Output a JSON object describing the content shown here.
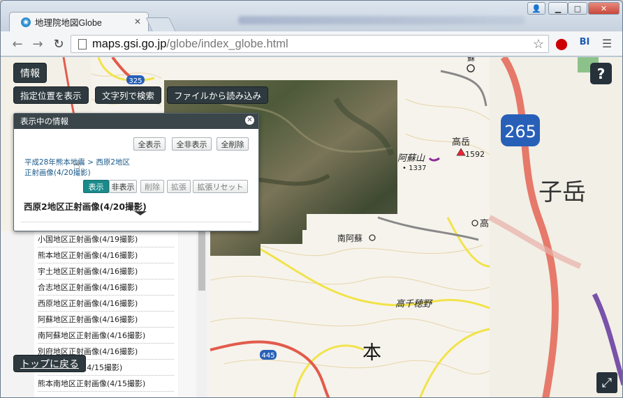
{
  "browser": {
    "tab_title": "地理院地図Globe",
    "url_host": "maps.gsi.go.jp",
    "url_path": "/globe/index_globe.html",
    "ext_bl_label": "BI"
  },
  "app": {
    "info_button": "情報",
    "show_location_button": "指定位置を表示",
    "text_search_button": "文字列で検索",
    "load_file_button": "ファイルから読み込み",
    "help_button": "?",
    "top_button": "トップに戻る"
  },
  "panel": {
    "title": "表示中の情報",
    "show_all": "全表示",
    "hide_all": "全非表示",
    "delete_all": "全削除",
    "layer_path_1": "平成28年熊本地震 > 西原2地区",
    "layer_path_2": "正射画像(4/20撮影)",
    "show": "表示",
    "hide": "非表示",
    "delete": "削除",
    "expand": "拡張",
    "expand_reset": "拡張リセット",
    "layer_title": "西原2地区正射画像(4/20撮影)"
  },
  "list": [
    "小国地区正射画像(4/19撮影)",
    "熊本地区正射画像(4/16撮影)",
    "宇土地区正射画像(4/16撮影)",
    "合志地区正射画像(4/16撮影)",
    "西原地区正射画像(4/16撮影)",
    "阿蘇地区正射画像(4/16撮影)",
    "南阿蘇地区正射画像(4/16撮影)",
    "別府地区正射画像(4/16撮影)",
    "地区正射画像(4/15撮影)",
    "熊本南地区正射画像(4/15撮影)"
  ],
  "map_labels": {
    "kitakata": "高岳",
    "elev_1592": "1592",
    "asosan": "阿蘇山",
    "elev_1337": "• 1337",
    "minamiaso": "南阿蘇",
    "takachiho": "高千穂野",
    "hon": "本",
    "route_265": "265",
    "route_325": "325",
    "route_445": "445",
    "taka": "高",
    "kodake": "子岳",
    "ka": "蘇"
  }
}
